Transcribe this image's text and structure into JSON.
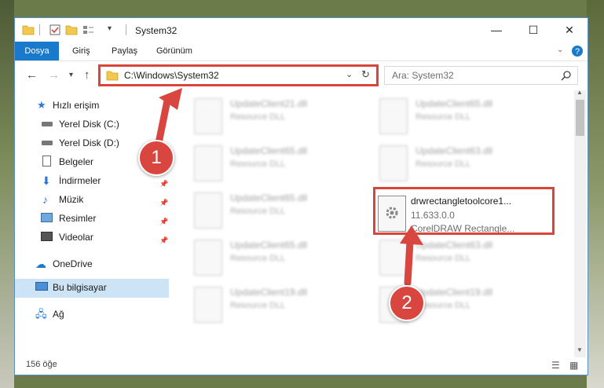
{
  "window": {
    "title": "System32",
    "minimize": "—",
    "maximize": "☐",
    "close": "✕"
  },
  "ribbon": {
    "tabs": [
      "Dosya",
      "Giriş",
      "Paylaş",
      "Görünüm"
    ]
  },
  "address": {
    "path": "C:\\Windows\\System32",
    "search_placeholder": "Ara: System32"
  },
  "nav": {
    "items": [
      {
        "label": "Hızlı erişim",
        "icon": "star-icon"
      },
      {
        "label": "Yerel Disk (C:)",
        "icon": "drive-icon"
      },
      {
        "label": "Yerel Disk (D:)",
        "icon": "drive-icon"
      },
      {
        "label": "Belgeler",
        "icon": "documents-icon"
      },
      {
        "label": "İndirmeler",
        "icon": "download-icon"
      },
      {
        "label": "Müzik",
        "icon": "music-icon"
      },
      {
        "label": "Resimler",
        "icon": "pictures-icon"
      },
      {
        "label": "Videolar",
        "icon": "videos-icon"
      },
      {
        "label": "OneDrive",
        "icon": "cloud-icon"
      },
      {
        "label": "Bu bilgisayar",
        "icon": "computer-icon"
      },
      {
        "label": "Ağ",
        "icon": "network-icon"
      }
    ]
  },
  "files": {
    "left": [
      {
        "name": "UpdateClient21.dll",
        "desc": "Resource DLL"
      },
      {
        "name": "UpdateClient65.dll",
        "desc": "Resource DLL"
      },
      {
        "name": "UpdateClient65.dll",
        "desc": "Resource DLL"
      },
      {
        "name": "UpdateClient65.dll",
        "desc": "Resource DLL"
      },
      {
        "name": "UpdateClient19.dll",
        "desc": "Resource DLL"
      }
    ],
    "right": [
      {
        "name": "UpdateClient65.dll",
        "desc": "Resource DLL"
      },
      {
        "name": "UpdateClient63.dll",
        "desc": "Resource DLL"
      },
      {
        "name": "UpdateClient63.dll",
        "desc": "Resource DLL"
      },
      {
        "name": "UpdateClient19.dll",
        "desc": "Resource DLL"
      }
    ],
    "selected": {
      "name": "drwrectangletoolcore1...",
      "version": "11.633.0.0",
      "desc": "CorelDRAW Rectangle..."
    }
  },
  "status": {
    "count": "156 öğe"
  },
  "markers": {
    "one": "1",
    "two": "2"
  },
  "colors": {
    "accent": "#1979ca",
    "highlight": "#d9453a"
  }
}
